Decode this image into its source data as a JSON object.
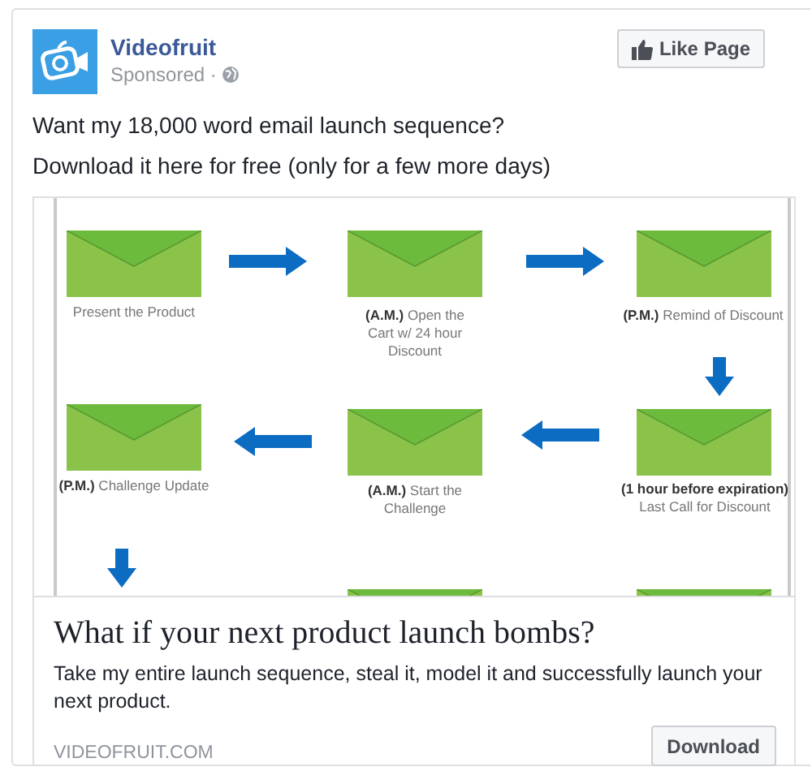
{
  "page": {
    "name": "Videofruit",
    "meta": "Sponsored ·",
    "like_button": "Like Page"
  },
  "message": [
    "Want my 18,000 word email launch sequence?",
    "Download it here for free (only for a few more days)"
  ],
  "diagram": {
    "steps": [
      {
        "label": "Present the Product"
      },
      {
        "label": "**(A.M.)** Open the Cart w/ 24 hour Discount"
      },
      {
        "label": "**(P.M.)** Remind of Discount"
      },
      {
        "label": "**(P.M.)** Challenge Update"
      },
      {
        "label": "**(A.M.)** Start the Challenge"
      },
      {
        "label": "**(1 hour before expiration)** Last Call for Discount"
      }
    ]
  },
  "attachment": {
    "title": "What if your next product launch bombs?",
    "description": "Take my entire launch sequence, steal it, model it and successfully launch your next product.",
    "domain": "VIDEOFRUIT.COM",
    "button": "Download"
  }
}
